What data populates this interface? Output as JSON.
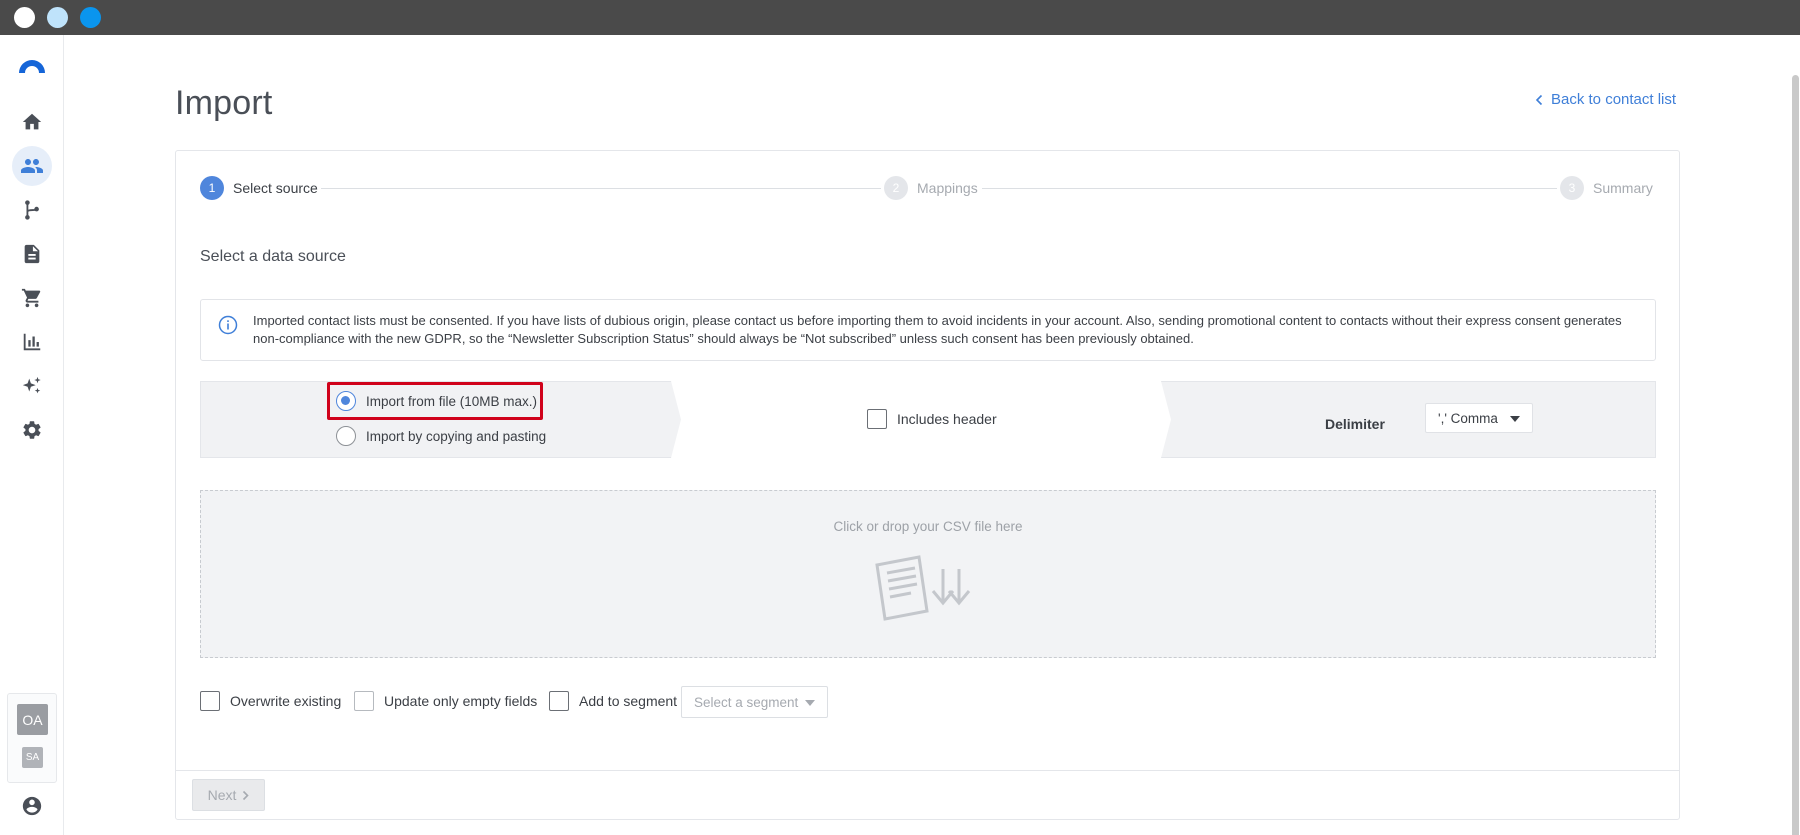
{
  "window": {
    "controls": [
      "close",
      "minimize",
      "maximize"
    ]
  },
  "sidebar": {
    "logo": "brand-logo",
    "items": [
      {
        "icon": "home-icon",
        "active": false
      },
      {
        "icon": "contacts-icon",
        "active": true
      },
      {
        "icon": "automation-icon",
        "active": false
      },
      {
        "icon": "document-icon",
        "active": false
      },
      {
        "icon": "cart-icon",
        "active": false
      },
      {
        "icon": "reports-icon",
        "active": false
      },
      {
        "icon": "sparkle-icon",
        "active": false
      },
      {
        "icon": "gear-icon",
        "active": false
      }
    ],
    "accounts": {
      "primary": "OA",
      "secondary": "SA"
    },
    "profile_icon": "user-icon"
  },
  "header": {
    "title": "Import",
    "back_link": "Back to contact list"
  },
  "stepper": {
    "steps": [
      {
        "number": "1",
        "label": "Select source",
        "active": true
      },
      {
        "number": "2",
        "label": "Mappings",
        "active": false
      },
      {
        "number": "3",
        "label": "Summary",
        "active": false
      }
    ]
  },
  "source": {
    "title": "Select a data source",
    "notice": "Imported contact lists must be consented. If you have lists of dubious origin, please contact us before importing them to avoid incidents in your account. Also, sending promotional content to contacts without their express consent generates non-compliance with the new GDPR, so the “Newsletter Subscription Status” should always be “Not subscribed” unless such consent has been previously obtained.",
    "options": [
      {
        "label": "Import from file (10MB max.)",
        "checked": true
      },
      {
        "label": "Import by copying and pasting",
        "checked": false
      }
    ],
    "includes_header": "Includes header",
    "delimiter_label": "Delimiter",
    "delimiter_value": "',' Comma"
  },
  "dropzone": {
    "text": "Click or drop your CSV file here",
    "icon": "file-drop-icon"
  },
  "options": {
    "overwrite": "Overwrite existing",
    "update_empty": "Update only empty fields",
    "add_segment": "Add to segment",
    "segment_placeholder": "Select a segment"
  },
  "footer": {
    "next_label": "Next"
  },
  "colors": {
    "accent": "#4f86dc",
    "highlight": "#d0021b",
    "link": "#3f7fd8"
  }
}
